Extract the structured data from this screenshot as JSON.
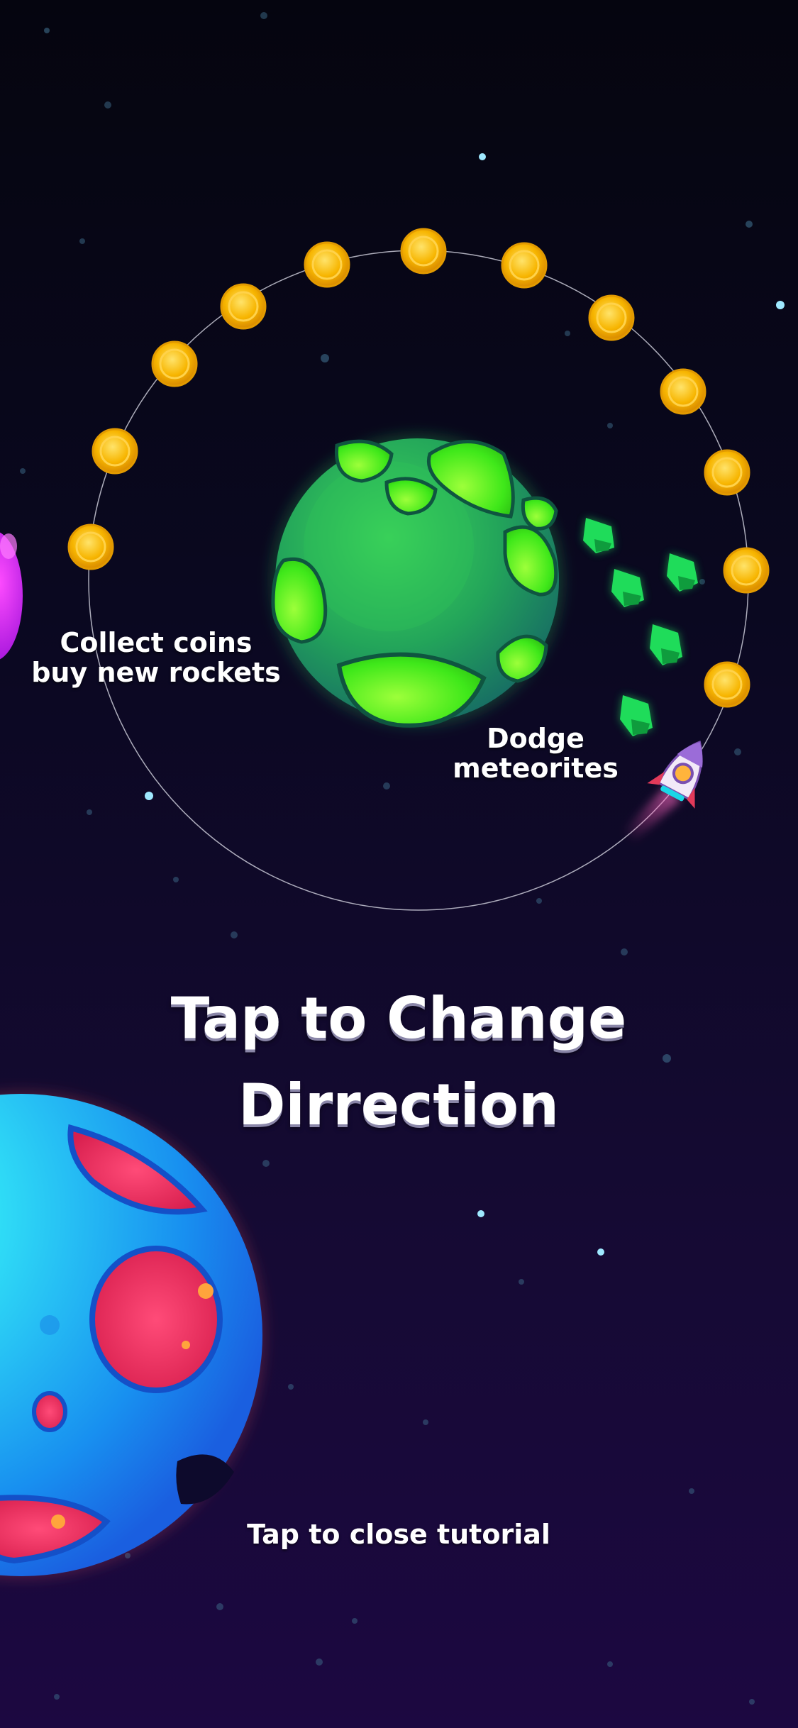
{
  "labels": {
    "collect_line1": "Collect coins",
    "collect_line2": "buy new rockets",
    "dodge_line1": "Dodge",
    "dodge_line2": "meteorites",
    "tap_line1": "Tap to Change",
    "tap_line2": "Dirrection",
    "close": "Tap to close tutorial"
  },
  "colors": {
    "background_top": "#05050f",
    "background_bottom": "#1c0841",
    "coin": "#f7b500",
    "green_planet": "#2fbf4a",
    "meteorite": "#1fdc5a",
    "blue_planet": "#18b8f0",
    "crater_red": "#f03262",
    "text": "#ffffff"
  }
}
